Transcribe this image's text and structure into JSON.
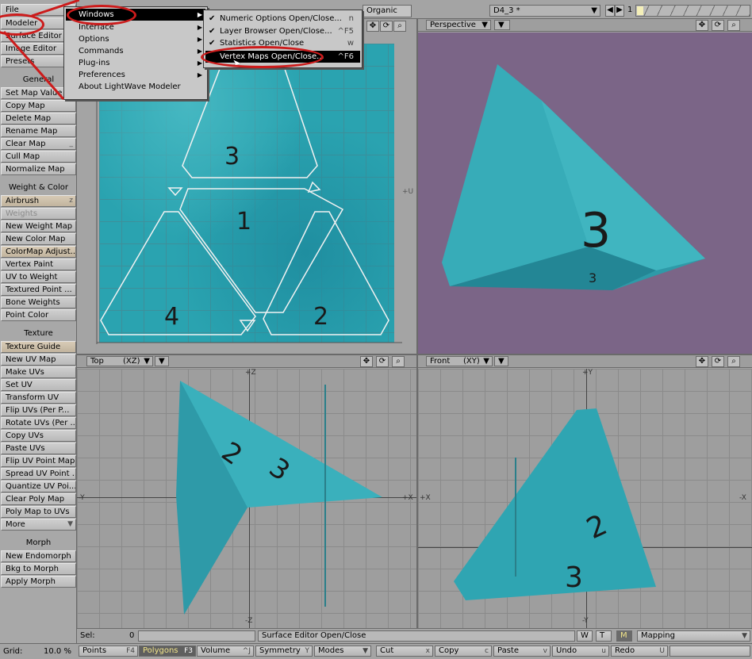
{
  "top": {
    "file": "File",
    "modeler": "Modeler",
    "surface_editor": "Surface Editor",
    "image_editor": "Image Editor",
    "presets": "Presets",
    "tab_organic": "Organic",
    "scene_name": "D4_3 *",
    "layer_num": "1"
  },
  "windows_menu": {
    "title": "Windows",
    "items": [
      {
        "label": "Interface"
      },
      {
        "label": "Options"
      },
      {
        "label": "Commands"
      },
      {
        "label": "Plug-ins"
      },
      {
        "label": "Preferences"
      },
      {
        "label": "About LightWave Modeler"
      }
    ]
  },
  "submenu": {
    "items": [
      {
        "label": "Numeric Options Open/Close...",
        "shortcut": "n",
        "check": "✔"
      },
      {
        "label": "Layer Browser Open/Close...",
        "shortcut": "^F5",
        "check": "✔"
      },
      {
        "label": "Statistics Open/Close",
        "shortcut": "w",
        "check": "✔"
      },
      {
        "label": "Vertex Maps Open/Close...",
        "shortcut": "^F6",
        "check": ""
      }
    ]
  },
  "toolbar": {
    "general": "General",
    "set_map_value": "Set Map Value",
    "copy_map": "Copy Map",
    "delete_map": "Delete Map",
    "rename_map": "Rename Map",
    "clear_map": "Clear Map",
    "cull_map": "Cull Map",
    "normalize_map": "Normalize Map",
    "weight_color": "Weight & Color",
    "airbrush": "Airbrush",
    "airbrush_sc": "z",
    "weights": "Weights",
    "new_weight_map": "New Weight Map",
    "new_color_map": "New Color Map",
    "colormap_adjust": "ColorMap Adjust...",
    "vertex_paint": "Vertex Paint",
    "uv_to_weight": "UV to Weight",
    "textured_point": "Textured Point ...",
    "bone_weights": "Bone Weights",
    "point_color": "Point Color",
    "texture": "Texture",
    "texture_guide": "Texture Guide",
    "new_uv_map": "New UV Map",
    "make_uvs": "Make UVs",
    "set_uv": "Set UV",
    "transform_uv": "Transform UV",
    "flip_uvs": "Flip UVs (Per P...",
    "rotate_uvs": "Rotate UVs (Per ...",
    "copy_uvs": "Copy UVs",
    "paste_uvs": "Paste UVs",
    "flip_uv_point_map": "Flip UV Point Map",
    "spread_uv_point": "Spread UV Point ...",
    "quantize_uv": "Quantize UV Poi...",
    "clear_poly_map": "Clear Poly Map",
    "poly_map_to_uvs": "Poly Map to UVs",
    "more": "More",
    "morph": "Morph",
    "new_endomorph": "New Endomorph",
    "bkg_to_morph": "Bkg to Morph",
    "apply_morph": "Apply Morph"
  },
  "viewports": {
    "uv_axis": "+U",
    "perspective": "Perspective",
    "top": "Top",
    "top_axes": "(XZ)",
    "front": "Front",
    "front_axes": "(XY)",
    "top_pz": "+Z",
    "top_nz": "-Z",
    "top_px": "+X",
    "top_nx": "-Y",
    "front_py": "+Y",
    "front_ny": "-Y",
    "front_px": "+X",
    "front_nx": "-X"
  },
  "status": {
    "sel_label": "Sel:",
    "sel_value": "0",
    "message": "Surface Editor Open/Close",
    "w": "W",
    "t": "T",
    "m": "M",
    "mapping": "Mapping"
  },
  "bottom": {
    "grid_label": "Grid:",
    "grid_value": "10.0 %",
    "points": "Points",
    "points_sc": "F4",
    "polygons": "Polygons",
    "polygons_sc": "F3",
    "volume": "Volume",
    "volume_sc": "^J",
    "symmetry": "Symmetry",
    "symmetry_sc": "Y",
    "modes": "Modes",
    "cut": "Cut",
    "cut_sc": "x",
    "copy": "Copy",
    "copy_sc": "c",
    "paste": "Paste",
    "paste_sc": "v",
    "undo": "Undo",
    "undo_sc": "u",
    "redo": "Redo",
    "redo_sc": "U"
  },
  "accent_colors": {
    "highlight_ellipse": "#cc1b1b",
    "menu_selected": "#000000",
    "perspective_bg": "#7b6587",
    "texture": "#2aa3b0"
  }
}
